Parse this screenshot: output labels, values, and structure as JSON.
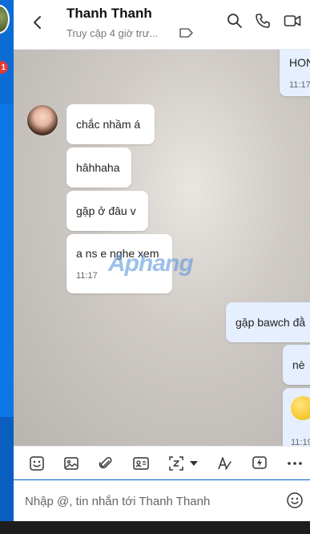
{
  "header": {
    "contact_name": "Thanh Thanh",
    "status": "Truy cập 4 giờ trư..."
  },
  "messages": {
    "incoming": [
      {
        "text": "chắc nhầm á"
      },
      {
        "text": "hâhhaha"
      },
      {
        "text": "gặp ở đâu v"
      },
      {
        "text": "a ns e nghe xem",
        "time": "11:17"
      }
    ],
    "outgoing": [
      {
        "text": "HON",
        "time": "11:17"
      },
      {
        "text": "gặp bawch đằ"
      },
      {
        "text": "nè"
      },
      {
        "time": "11:19"
      }
    ],
    "watermark": {
      "part1": "A",
      "part2": "phang"
    }
  },
  "composer": {
    "placeholder": "Nhập @, tin nhắn tới Thanh Thanh"
  },
  "sidebar": {
    "unread_badge": "1"
  },
  "colors": {
    "accent": "#0b6cd6",
    "badge": "#e53935"
  }
}
